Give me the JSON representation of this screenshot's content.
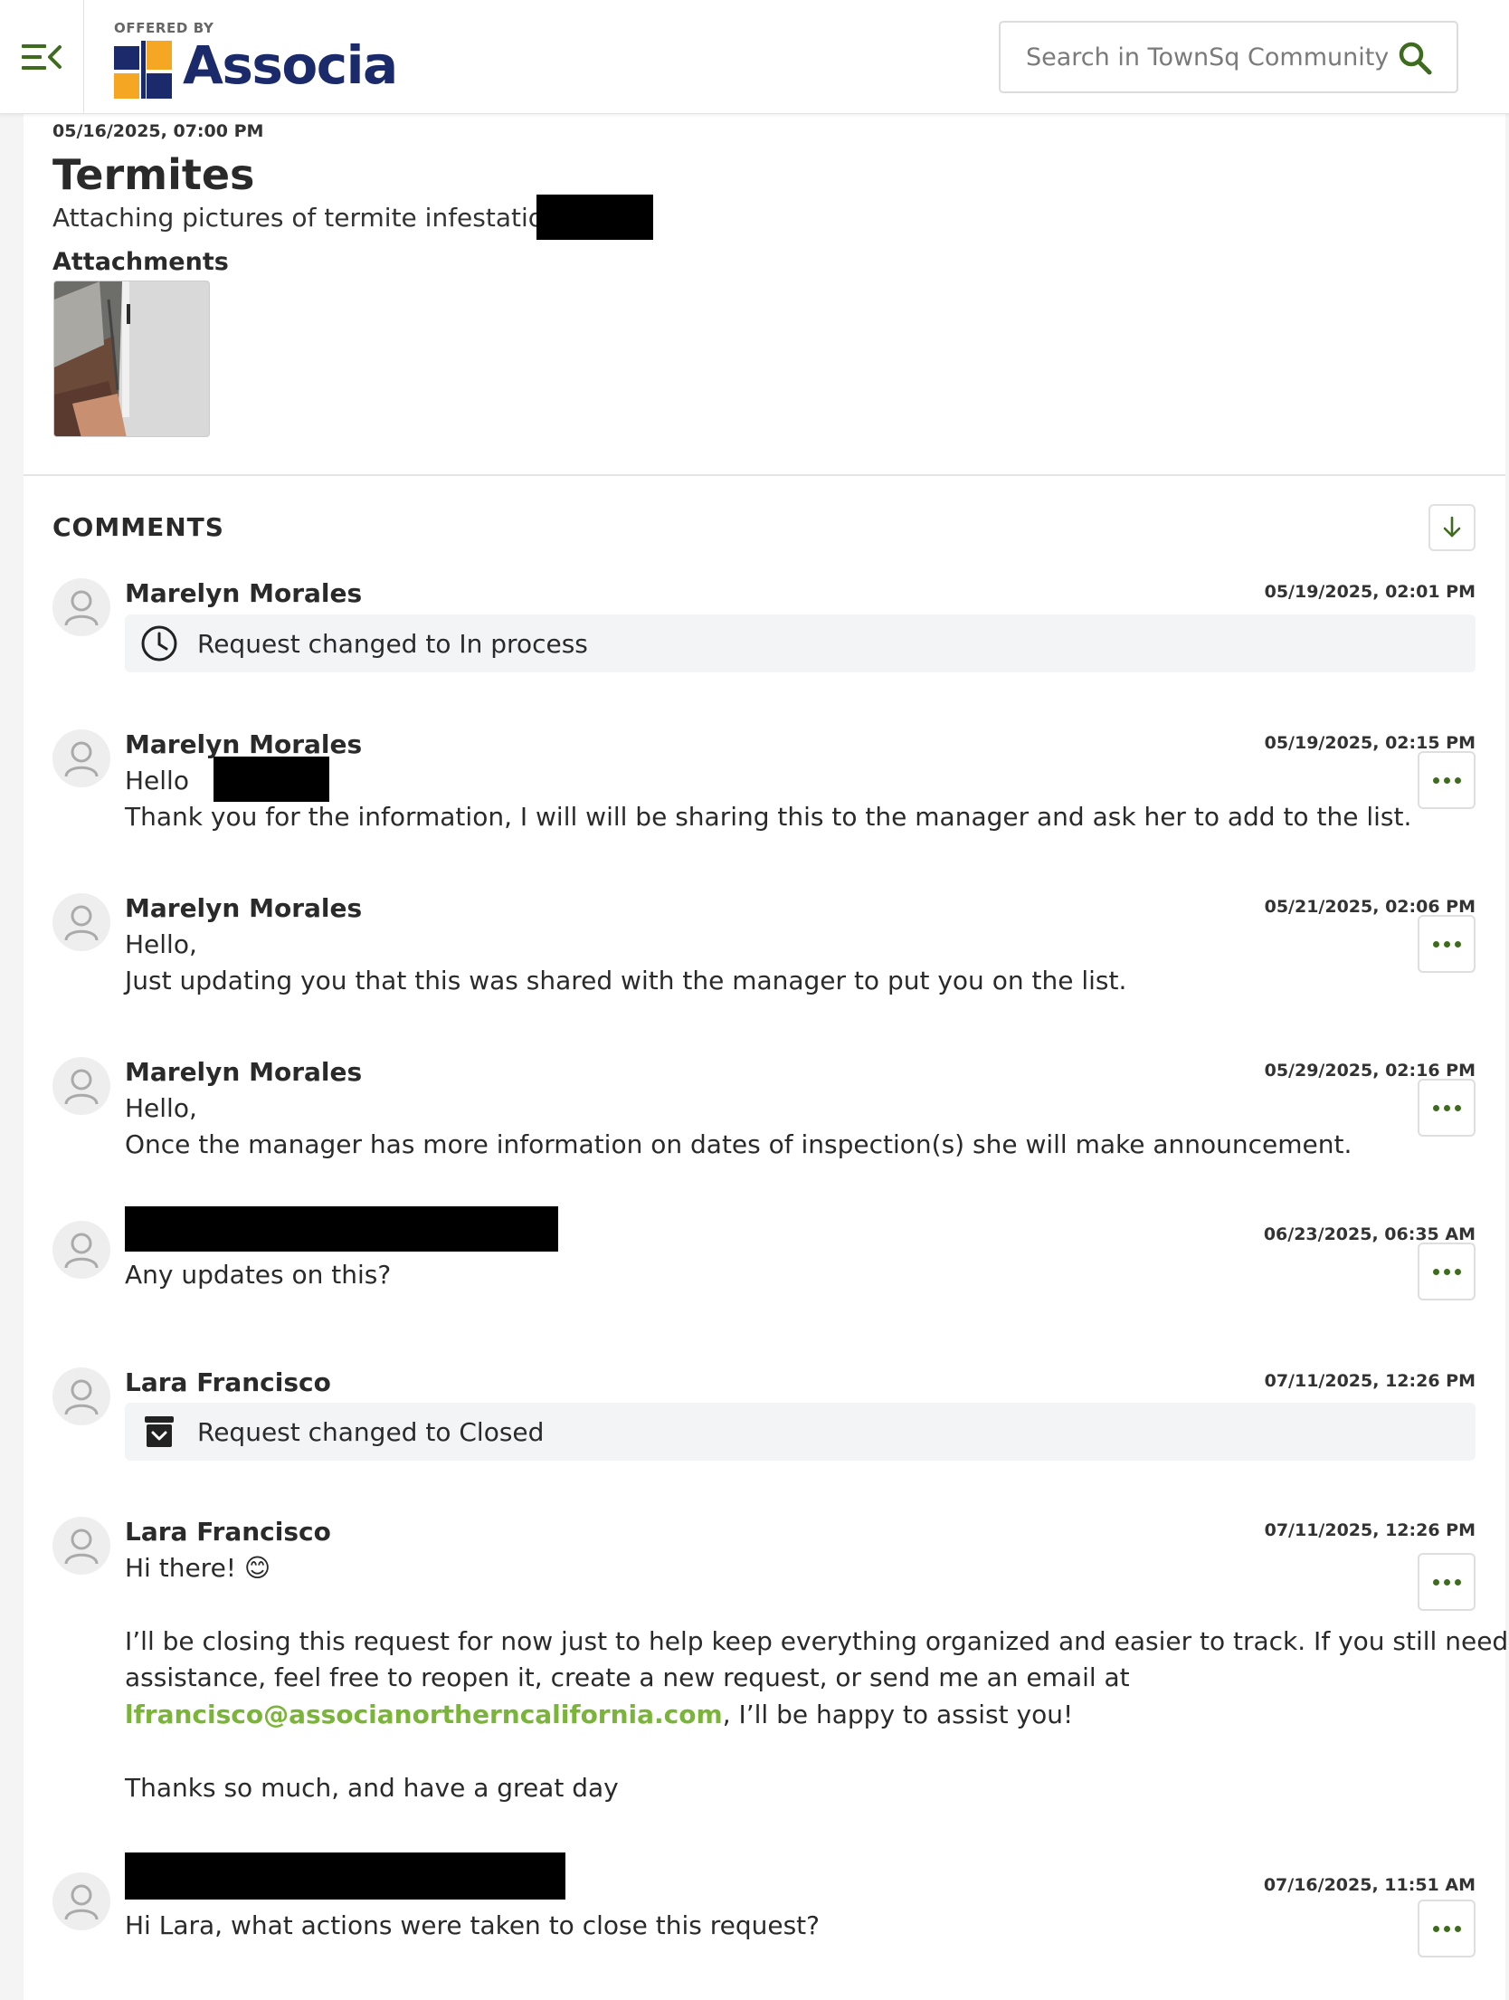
{
  "header": {
    "offered_by": "OFFERED BY",
    "brand": "Associa",
    "brand_reg": "®",
    "search_placeholder": "Search in TownSq Community",
    "colors": {
      "accent": "#3f6b1f",
      "brand_blue": "#1b2a6b",
      "brand_orange": "#f5a623"
    }
  },
  "post": {
    "date": "05/16/2025, 07:00 PM",
    "title": "Termites",
    "body": "Attaching pictures of termite infestation in",
    "attachments_label": "Attachments"
  },
  "comments_section": {
    "heading": "COMMENTS",
    "items": [
      {
        "author": "Marelyn Morales",
        "timestamp": "05/19/2025, 02:01 PM",
        "status": "Request changed to In process",
        "status_icon": "clock-icon"
      },
      {
        "author": "Marelyn Morales",
        "timestamp": "05/19/2025, 02:15 PM",
        "line1": "Hello",
        "line2": "Thank you for the information, I will will be sharing this to the manager and ask her to add to the list."
      },
      {
        "author": "Marelyn Morales",
        "timestamp": "05/21/2025, 02:06 PM",
        "line1": "Hello,",
        "line2": "Just updating you that this was shared with the manager to put you on the list."
      },
      {
        "author": "Marelyn Morales",
        "timestamp": "05/29/2025, 02:16 PM",
        "line1": "Hello,",
        "line2": "Once the manager has more information  on dates of inspection(s) she will make announcement."
      },
      {
        "author": "",
        "timestamp": "06/23/2025, 06:35 AM",
        "line1": "Any updates on this?"
      },
      {
        "author": "Lara Francisco",
        "timestamp": "07/11/2025, 12:26 PM",
        "status": "Request changed to Closed",
        "status_icon": "archive-icon"
      },
      {
        "author": "Lara Francisco",
        "timestamp": "07/11/2025, 12:26 PM",
        "line1": "Hi there! 😊",
        "para1_a": "I’ll be closing this request for now just to help keep everything organized and easier to track. If you still need",
        "para1_b": "assistance, feel free to reopen it, create a new request, or send me an email at",
        "email": "lfrancisco@associanortherncalifornia.com",
        "para1_c": ", I’ll be happy to assist you!",
        "para2": "Thanks so much, and have a great day"
      },
      {
        "author": "",
        "timestamp": "07/16/2025, 11:51 AM",
        "line1": "Hi Lara, what actions were taken to close this request?"
      }
    ]
  }
}
